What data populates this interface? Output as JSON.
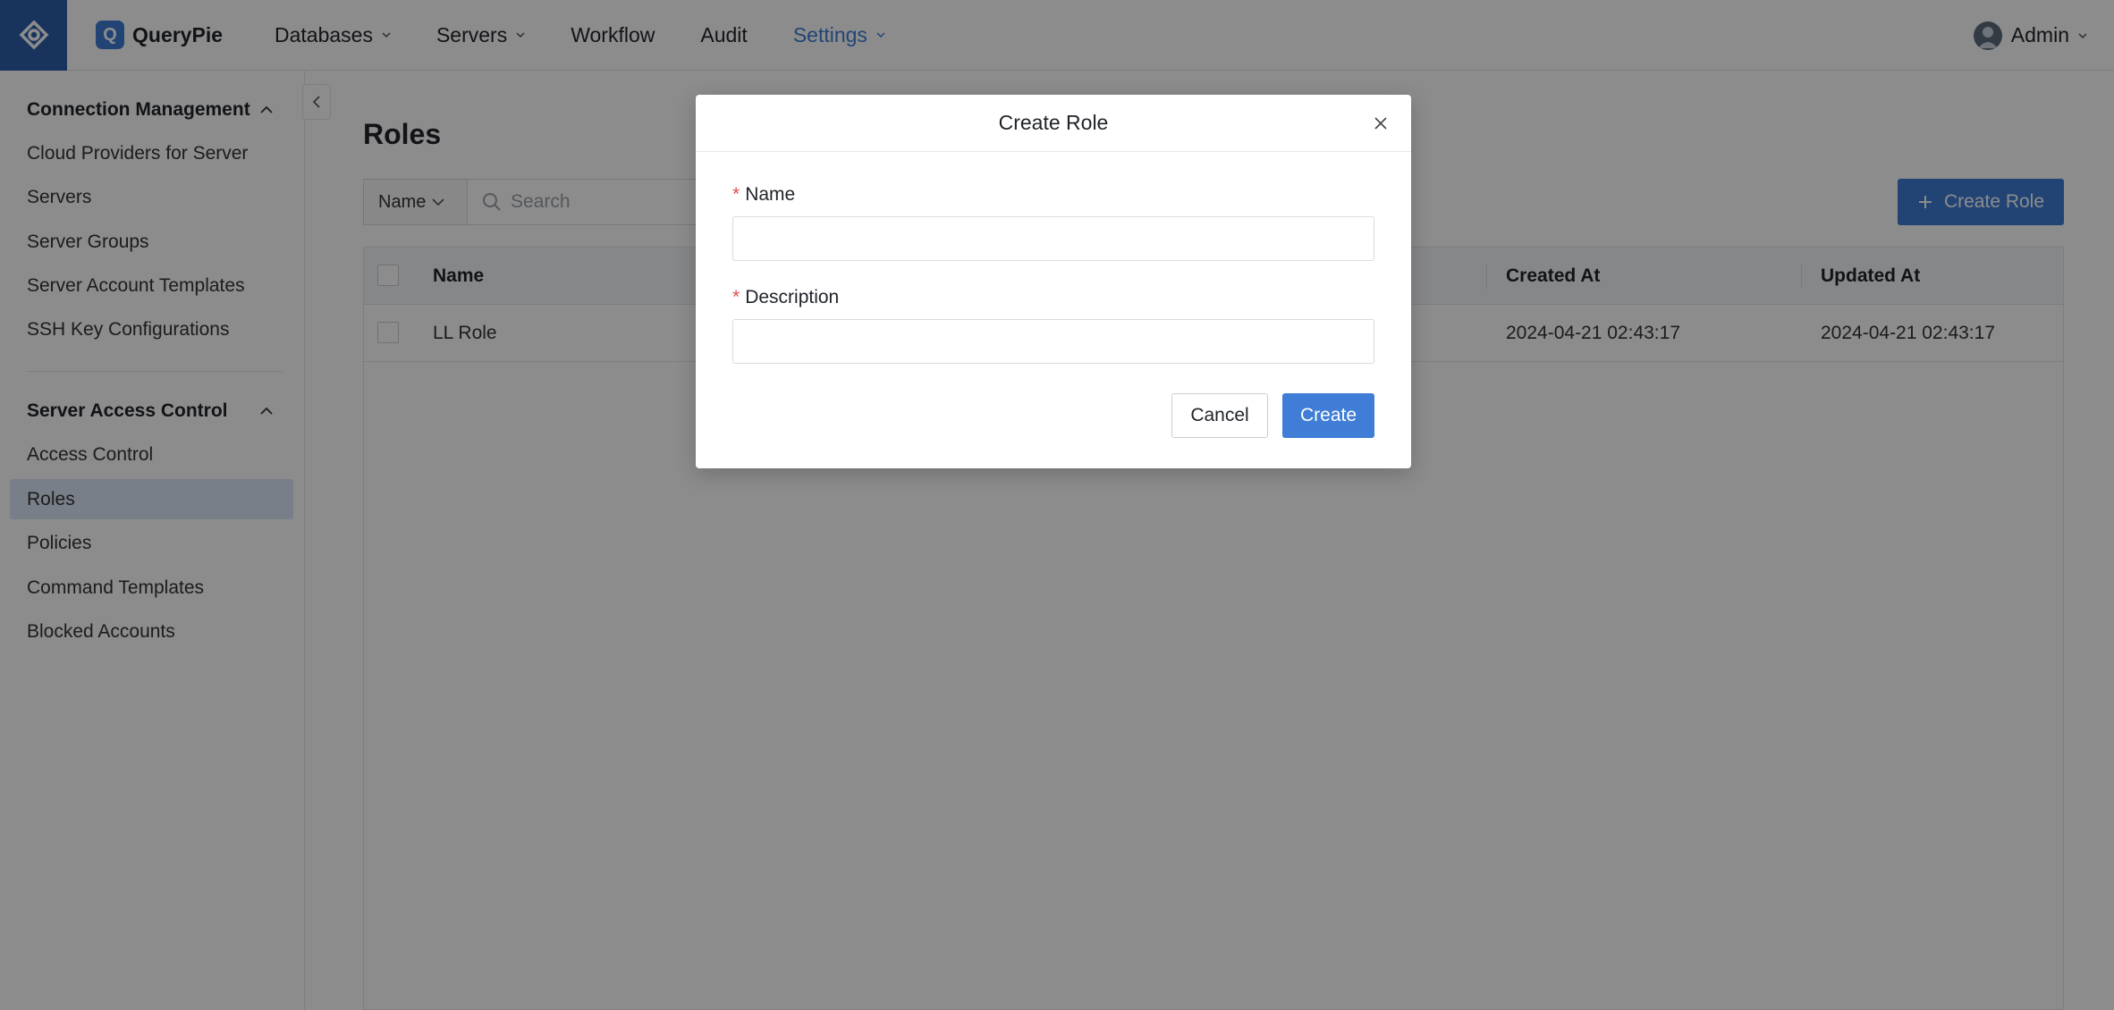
{
  "header": {
    "brand": "QueryPie",
    "brand_letter": "Q",
    "nav": [
      {
        "label": "Databases",
        "has_dropdown": true
      },
      {
        "label": "Servers",
        "has_dropdown": true
      },
      {
        "label": "Workflow",
        "has_dropdown": false
      },
      {
        "label": "Audit",
        "has_dropdown": false
      },
      {
        "label": "Settings",
        "has_dropdown": true,
        "active": true
      }
    ],
    "user": "Admin"
  },
  "sidebar": {
    "sections": [
      {
        "title": "Connection Management",
        "items": [
          "Cloud Providers for Server",
          "Servers",
          "Server Groups",
          "Server Account Templates",
          "SSH Key Configurations"
        ]
      },
      {
        "title": "Server Access Control",
        "items": [
          "Access Control",
          "Roles",
          "Policies",
          "Command Templates",
          "Blocked Accounts"
        ],
        "active_item": "Roles"
      }
    ]
  },
  "main": {
    "title": "Roles",
    "filter_value": "Name",
    "search_placeholder": "Search",
    "create_button": "Create Role",
    "columns": [
      "Name",
      "Created At",
      "Updated At"
    ],
    "rows": [
      {
        "name": "LL Role",
        "created_at": "2024-04-21 02:43:17",
        "updated_at": "2024-04-21 02:43:17"
      }
    ]
  },
  "modal": {
    "title": "Create Role",
    "fields": [
      {
        "label": "Name",
        "required": true,
        "value": ""
      },
      {
        "label": "Description",
        "required": true,
        "value": ""
      }
    ],
    "cancel_label": "Cancel",
    "submit_label": "Create"
  },
  "colors": {
    "accent": "#3f7dd6",
    "brand_square": "#2c5fa8",
    "required": "#e34d4d",
    "overlay": "rgba(0,0,0,0.45)"
  }
}
